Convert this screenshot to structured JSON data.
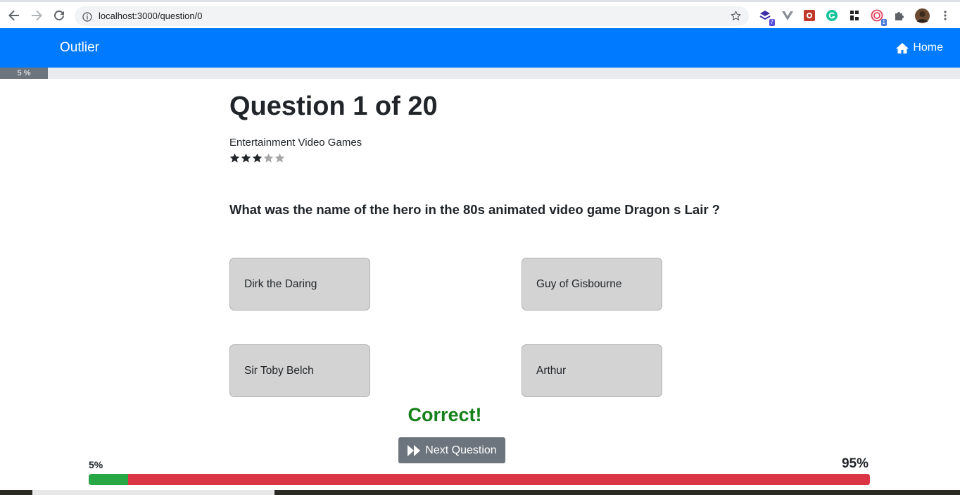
{
  "browser": {
    "url": "localhost:3000/question/0",
    "extensions": [
      {
        "icon": "layers-extension-icon",
        "badge": "7"
      },
      {
        "icon": "vue-devtools-icon",
        "badge": ""
      },
      {
        "icon": "red-extension-icon",
        "badge": ""
      },
      {
        "icon": "grammarly-icon",
        "badge": ""
      },
      {
        "icon": "grid-extension-icon",
        "badge": ""
      },
      {
        "icon": "target-extension-icon",
        "badge": "1"
      },
      {
        "icon": "puzzle-icon",
        "badge": ""
      }
    ]
  },
  "navbar": {
    "brand": "Outlier",
    "home_label": "Home",
    "accent": "#007bff"
  },
  "top_progress": {
    "label": "5 %",
    "value": 0.05
  },
  "question": {
    "heading": "Question 1 of 20",
    "category": "Entertainment Video Games",
    "difficulty_stars": 3,
    "max_stars": 5,
    "text": "What was the name of the hero in the 80s animated video game Dragon s Lair ?"
  },
  "answers": [
    {
      "label": "Dirk the Daring"
    },
    {
      "label": "Guy of Gisbourne"
    },
    {
      "label": "Sir Toby Belch"
    },
    {
      "label": "Arthur"
    }
  ],
  "result": {
    "text": "Correct!",
    "color": "#15801a"
  },
  "next_button": {
    "label": "Next Question"
  },
  "score": {
    "left_label": "5%",
    "right_label": "95%",
    "correct_fraction": 0.05,
    "correct_color": "#28a745",
    "incorrect_color": "#dc3545"
  }
}
